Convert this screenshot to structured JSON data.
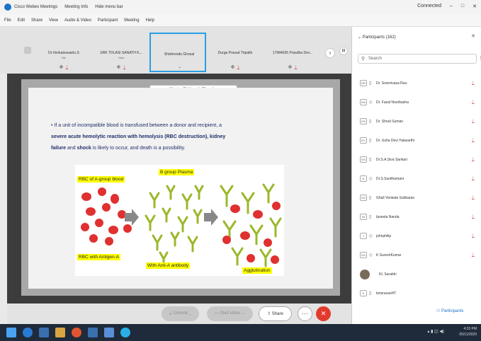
{
  "titlebar": {
    "app_name": "Cisco Webex Meetings",
    "meeting_info": "Meeting Info",
    "hide_menu_bar": "Hide menu bar",
    "status": "Connected",
    "window_controls": [
      "–",
      "□",
      "✕"
    ]
  },
  "menubar": [
    "File",
    "Edit",
    "Share",
    "View",
    "Audio & Video",
    "Participant",
    "Meeting",
    "Help"
  ],
  "strip": {
    "tiles": [
      {
        "name": "Dr.Venkateswarlu.S",
        "sub": "Me"
      },
      {
        "name": "SRK TOLASI SANATH K...",
        "sub": "Host"
      },
      {
        "name": "Shishrendu Ghosal",
        "sub": ""
      },
      {
        "name": "Durga Prasad Tripathi",
        "sub": ""
      },
      {
        "name": "17IM4026 Prasdha Dev...",
        "sub": ""
      }
    ],
    "next_label": "›",
    "grid_label": "⊟"
  },
  "share": {
    "viewing_tag": "Viewing Shishrendu Ghosal ...",
    "slide": {
      "line1": "If a unit of incompatible blood is transfused between a donor and recipient, a",
      "line2": "severe acute hemolytic reaction with hemolysis (RBC destruction), kidney",
      "line3_bold1": "failure",
      "line3_mid": " and ",
      "line3_bold2": "shock",
      "line3_rest": " is likely to occur, and death is a possibility.",
      "labels": {
        "rbc_a": "RBC of A-group blood",
        "b_plasma": "B group Plasma",
        "rbc_antigen": "RBC with Antigen-A",
        "anti_a": "With Anti-A antibody",
        "agglutination": "Agglutination"
      }
    }
  },
  "panel": {
    "title": "Participants (162)",
    "close": "✕",
    "search_placeholder": "Search",
    "participants": [
      {
        "initials": "DR",
        "device": "▯",
        "name": "Dr. Sreenivasa Rao"
      },
      {
        "initials": "DN",
        "device": "◇",
        "name": "Dr. Fazal Noorbasha"
      },
      {
        "initials": "DS",
        "device": "▯",
        "name": "Dr. Shruti Suman"
      },
      {
        "initials": "DY",
        "device": "▯",
        "name": "Dr. Usha Devi Yalavarthi"
      },
      {
        "initials": "DS",
        "device": "▯",
        "name": "Dr.S.A.Siva Sankari"
      },
      {
        "initials": "D",
        "device": "◇",
        "name": "Dr.S.Sunithamani"
      },
      {
        "initials": "GS",
        "device": "▯",
        "name": "Ghali Venkata Subbarao"
      },
      {
        "initials": "IN",
        "device": "▯",
        "name": "Ipseeta Nanda"
      },
      {
        "initials": "J",
        "device": "◇",
        "name": "johnphilip"
      },
      {
        "initials": "KS",
        "device": "◇",
        "name": "K SureshKumar"
      },
      {
        "initials": "",
        "device": "",
        "name": "KL Surabhi"
      },
      {
        "initials": "K",
        "device": "▯",
        "name": "kmsravanHT"
      }
    ],
    "participants_button": "Participants"
  },
  "controls": {
    "mute": "Unmute",
    "stop_video": "Start video",
    "share": "Share",
    "more": "···",
    "end": "✕"
  },
  "taskbar": {
    "time": "4:33 PM",
    "date": "05/11/2020"
  },
  "colors": {
    "accent": "#2a9ee5",
    "end_red": "#e23b2e",
    "mic_red": "#d33333",
    "highlight": "#ffff00",
    "rbc": "#e03030",
    "antibody": "#9ab82a"
  }
}
